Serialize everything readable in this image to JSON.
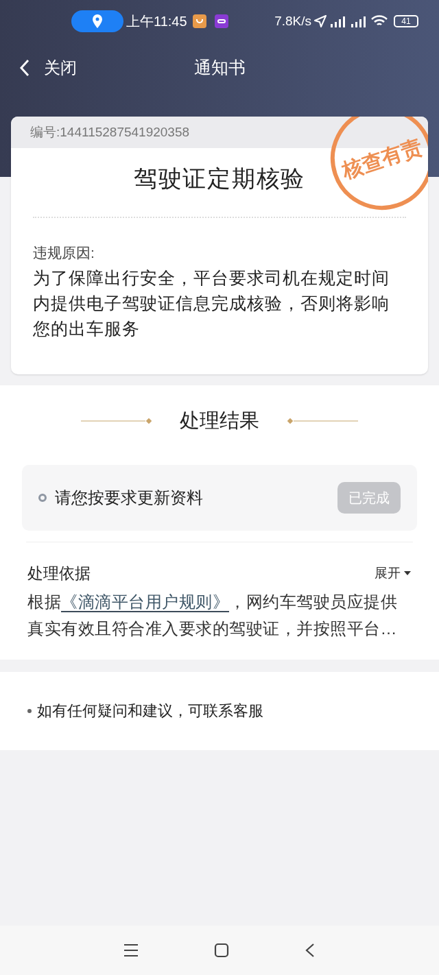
{
  "status_bar": {
    "time": "上午11:45",
    "speed": "7.8K/s",
    "battery": "41"
  },
  "nav": {
    "back": "关闭",
    "title": "通知书"
  },
  "card": {
    "number": "编号:144115287541920358",
    "stamp": "核查有责",
    "title": "驾驶证定期核验",
    "reason_label": "违规原因:",
    "reason": "为了保障出行安全，平台要求司机在规定时间内提供电子驾驶证信息完成核验，否则将影响您的出车服务"
  },
  "result": {
    "heading": "处理结果",
    "task": {
      "label": "请您按要求更新资料",
      "button": "已完成",
      "disabled": true
    }
  },
  "basis": {
    "title": "处理依据",
    "toggle": "展开",
    "expanded": false,
    "prefix": "根据",
    "link": "《滴滴平台用户规则》",
    "suffix": "，网约车驾驶员应提供真实有效且符合准入要求的驾驶证，并按照平台…"
  },
  "contact": {
    "text": "如有任何疑问和建议，可联系客服"
  }
}
